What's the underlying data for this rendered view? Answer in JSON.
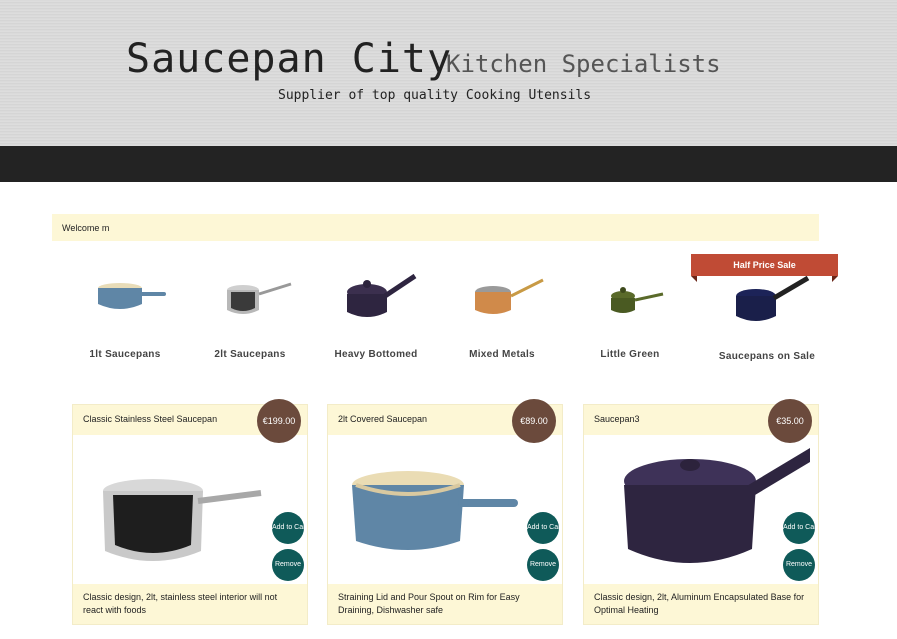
{
  "header": {
    "title": "Saucepan City",
    "subtitle": "Kitchen Specialists",
    "tagline": "Supplier of top quality Cooking Utensils"
  },
  "welcome": "Welcome m",
  "categories": [
    {
      "label": "1lt Saucepans"
    },
    {
      "label": "2lt Saucepans"
    },
    {
      "label": "Heavy Bottomed"
    },
    {
      "label": "Mixed Metals"
    },
    {
      "label": "Little Green"
    },
    {
      "label": "Saucepans on Sale"
    }
  ],
  "sale_banner": "Half Price Sale",
  "products": [
    {
      "name": "Classic Stainless Steel Saucepan",
      "price": "€199.00",
      "add_label": "Add to Cart",
      "remove_label": "Remove",
      "description": "Classic design, 2lt, stainless steel interior will not react with foods"
    },
    {
      "name": "2lt Covered Saucepan",
      "price": "€89.00",
      "add_label": "Add to Cart",
      "remove_label": "Remove",
      "description": "Straining Lid and Pour Spout on Rim for Easy Draining, Dishwasher safe"
    },
    {
      "name": "Saucepan3",
      "price": "€35.00",
      "add_label": "Add to Cart",
      "remove_label": "Remove",
      "description": "Classic design, 2lt, Aluminum Encapsulated Base for Optimal Heating"
    }
  ],
  "colors": {
    "nav": "#232323",
    "cream": "#fdf7d6",
    "price_badge": "#6b4a3c",
    "action_button": "#0f5a59",
    "sale_banner": "#c04b35"
  }
}
